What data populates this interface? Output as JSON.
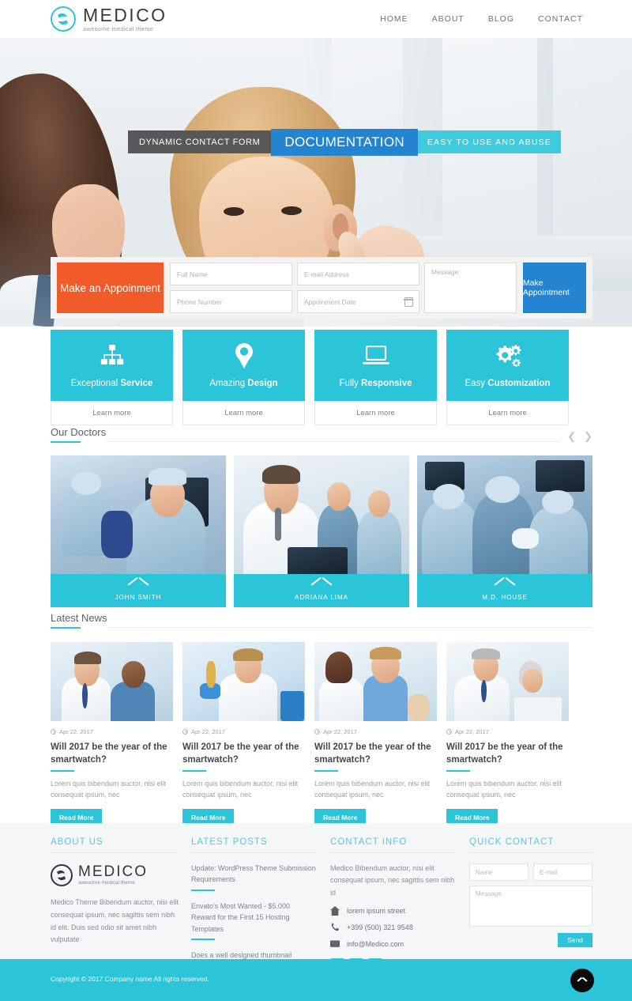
{
  "header": {
    "logo": {
      "name": "MEDICO",
      "tagline": "awesome medical theme",
      "icon": "circle-leaf-logo-icon"
    },
    "nav": [
      {
        "label": "HOME"
      },
      {
        "label": "ABOUT"
      },
      {
        "label": "BLOG"
      },
      {
        "label": "CONTACT"
      }
    ]
  },
  "hero": {
    "captions": [
      {
        "text": "DYNAMIC CONTACT FORM",
        "color": "#58585a"
      },
      {
        "text": "DOCUMENTATION",
        "color": "#2484cf"
      },
      {
        "text": "EASY TO USE AND ABUSE",
        "color": "#3ecbdd"
      }
    ]
  },
  "appointment": {
    "cta_label": "Make an Appoinment",
    "full_name_placeholder": "Full Name",
    "email_placeholder": "E-mail Address",
    "phone_placeholder": "Phone Number",
    "date_placeholder": "Appoinment Date",
    "message_placeholder": "Message",
    "submit_label": "Make Appointment",
    "cta_color": "#f15a29",
    "submit_color": "#2484cf"
  },
  "features": {
    "learn_more_label": "Learn more",
    "items": [
      {
        "icon": "sitemap-icon",
        "light": "Exceptional",
        "bold": "Service"
      },
      {
        "icon": "lightbulb-icon",
        "light": "Amazing",
        "bold": "Design"
      },
      {
        "icon": "laptop-icon",
        "light": "Fully",
        "bold": "Responsive"
      },
      {
        "icon": "gears-icon",
        "light": "Easy",
        "bold": "Customization"
      }
    ]
  },
  "doctors": {
    "section_title": "Our Doctors",
    "prev_icon": "chevron-left-icon",
    "next_icon": "chevron-right-icon",
    "items": [
      {
        "name": "JOHN SMITH"
      },
      {
        "name": "ADRIANA LIMA"
      },
      {
        "name": "M.D. HOUSE"
      }
    ]
  },
  "news": {
    "section_title": "Latest News",
    "items": [
      {
        "date": "Apr 22, 2017",
        "title": "Will 2017 be the year of the smartwatch?",
        "excerpt": "Lorem quis bibendum auctor, nisi elit consequat ipsum, nec",
        "button": "Read More"
      },
      {
        "date": "Apr 22, 2017",
        "title": "Will 2017 be the year of the smartwatch?",
        "excerpt": "Lorem quis bibendum auctor, nisi elit consequat ipsum, nec",
        "button": "Read More"
      },
      {
        "date": "Apr 22, 2017",
        "title": "Will 2017 be the year of the smartwatch?",
        "excerpt": "Lorem quis bibendum auctor, nisi elit consequat ipsum, nec",
        "button": "Read More"
      },
      {
        "date": "Apr 22, 2017",
        "title": "Will 2017 be the year of the smartwatch?",
        "excerpt": "Lorem quis bibendum auctor, nisi elit consequat ipsum, nec",
        "button": "Read More"
      }
    ]
  },
  "footer": {
    "about": {
      "heading": "ABOUT US",
      "logo_name": "MEDICO",
      "logo_tagline": "awesome medical theme",
      "text": "Medico Theme Bibendum auctor, nisi elit consequat ipsum, nec sagittis sem nibh id elit. Duis sed odio sit amet nibh vulputate"
    },
    "latest_posts": {
      "heading": "LATEST POSTS",
      "items": [
        {
          "title": "Update: WordPress Theme Submission Requirements"
        },
        {
          "title": "Envato's Most Wanted - $5.000 Reward for the First 15 Hosting Templates"
        },
        {
          "title": "Does a well designed thumbnail increase your sales?"
        }
      ]
    },
    "contact_info": {
      "heading": "CONTACT INFO",
      "text": "Medico Bibendum auctor, nisi elit consequat ipsum, nec sagittis sem nibh id",
      "address": "lorem ipsum street",
      "phone": "+399 (500) 321 9548",
      "email": "info@Medico.com",
      "socials": [
        {
          "name": "pinterest-icon",
          "glyph": "P"
        },
        {
          "name": "twitter-icon",
          "glyph": "t"
        },
        {
          "name": "facebook-icon",
          "glyph": "f"
        }
      ]
    },
    "quick_contact": {
      "heading": "QUICK CONTACT",
      "name_placeholder": "Name",
      "email_placeholder": "E-mail",
      "message_placeholder": "Message",
      "send_label": "Send"
    }
  },
  "copyright": {
    "text": "Copyright © 2017.Company name All rights reserved.",
    "to_top_icon": "chevron-up-icon",
    "bar_color": "#2bc4d8"
  },
  "theme": {
    "accent": "#2bc4d8",
    "blue": "#2484cf",
    "orange": "#f15a29"
  }
}
